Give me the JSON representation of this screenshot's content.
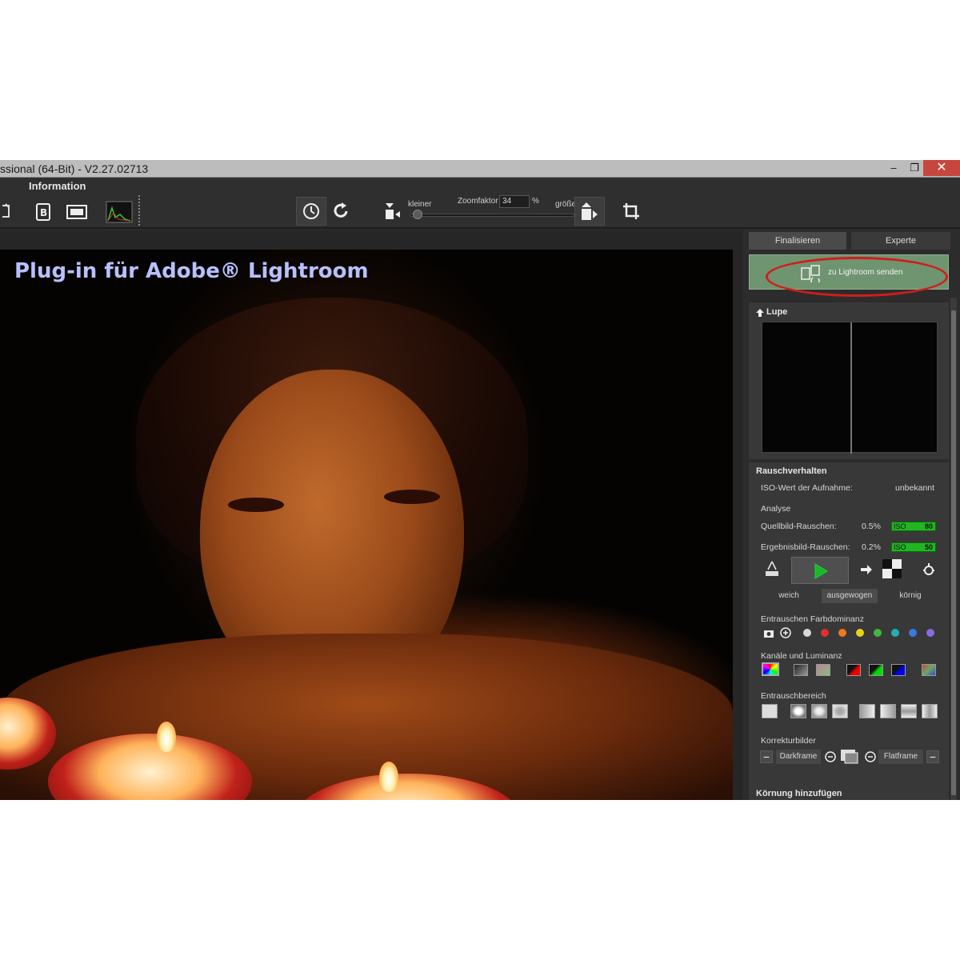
{
  "window": {
    "title": "ssional (64-Bit) - V2.27.02713",
    "minimize": "–",
    "maximize": "❐",
    "close": "✕"
  },
  "toolbar": {
    "menu_info": "Information",
    "zoom_smaller": "kleiner",
    "zoom_larger": "größer",
    "zoom_label": "Zoomfaktor",
    "zoom_value": "34",
    "zoom_unit": "%"
  },
  "image": {
    "overlay_title": "Plug-in für Adobe® Lightroom"
  },
  "panel": {
    "tabs": [
      "Finalisieren",
      "Experte"
    ],
    "send_button": "zu Lightroom senden",
    "lupe_title": "Lupe",
    "noise_title": "Rauschverhalten",
    "iso_label": "ISO-Wert der Aufnahme:",
    "iso_value": "unbekannt",
    "analysis_label": "Analyse",
    "source_noise_label": "Quellbild-Rauschen:",
    "source_noise_value": "0.5%",
    "source_iso_tag": "ISO",
    "source_iso_value": "80",
    "result_noise_label": "Ergebnisbild-Rauschen:",
    "result_noise_value": "0.2%",
    "result_iso_tag": "ISO",
    "result_iso_value": "50",
    "modes": [
      "weich",
      "ausgewogen",
      "körnig"
    ],
    "color_dominance_label": "Entrauschen Farbdominanz",
    "dominance_colors": [
      "#d8d8d8",
      "#e03030",
      "#f07a18",
      "#e6d21a",
      "#3fb83f",
      "#1fb0b0",
      "#3a7ae0",
      "#8a6ae0"
    ],
    "channels_label": "Kanäle und Luminanz",
    "range_label": "Entrauschbereich",
    "correction_label": "Korrekturbilder",
    "darkframe": "Darkframe",
    "flatframe": "Flatframe",
    "grain_label": "Körnung hinzufügen"
  },
  "colors": {
    "send_button_bg": "#6f9470",
    "highlight_oval": "#d21c1c",
    "iso_bar": "#22b522"
  }
}
